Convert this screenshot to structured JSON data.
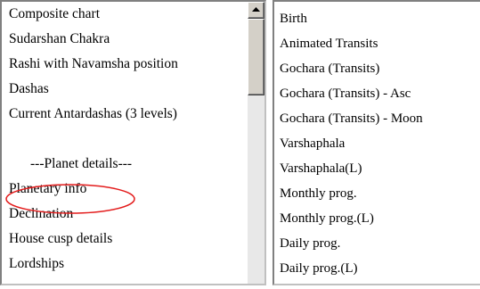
{
  "left_list": {
    "items": [
      "Composite chart",
      "Sudarshan Chakra",
      "Rashi with Navamsha position",
      "Dashas",
      "Current Antardashas (3 levels)",
      "",
      "---Planet details---",
      "Planetary info",
      "Declination",
      "House cusp details",
      "Lordships"
    ]
  },
  "right_list": {
    "items": [
      "Birth",
      "Animated Transits",
      "Gochara (Transits)",
      "Gochara (Transits) - Asc",
      "Gochara (Transits) - Moon",
      "Varshaphala",
      "Varshaphala(L)",
      "Monthly prog.",
      "Monthly prog.(L)",
      "Daily prog.",
      "Daily prog.(L)"
    ]
  },
  "icons": {
    "scroll_up": "triangle-up-icon"
  },
  "colors": {
    "highlight_ellipse": "#e31b1b"
  }
}
